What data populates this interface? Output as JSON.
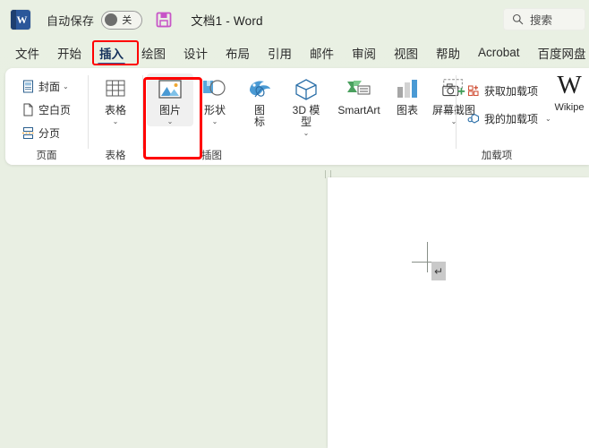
{
  "titlebar": {
    "app_logo": "word-logo",
    "logo_letter": "W",
    "autosave_label": "自动保存",
    "autosave_state": "关",
    "save_icon": "save-disk-icon",
    "document_title": "文档1 - Word"
  },
  "search": {
    "icon": "search-icon",
    "placeholder": "搜索"
  },
  "tabs": [
    {
      "label": "文件",
      "active": false
    },
    {
      "label": "开始",
      "active": false
    },
    {
      "label": "插入",
      "active": true
    },
    {
      "label": "绘图",
      "active": false
    },
    {
      "label": "设计",
      "active": false
    },
    {
      "label": "布局",
      "active": false
    },
    {
      "label": "引用",
      "active": false
    },
    {
      "label": "邮件",
      "active": false
    },
    {
      "label": "审阅",
      "active": false
    },
    {
      "label": "视图",
      "active": false
    },
    {
      "label": "帮助",
      "active": false
    },
    {
      "label": "Acrobat",
      "active": false
    },
    {
      "label": "百度网盘",
      "active": false
    }
  ],
  "ribbon": {
    "groups": [
      {
        "name": "pages",
        "label": "页面",
        "small_buttons": [
          {
            "label": "封面",
            "icon": "cover-page-icon",
            "caret": "⌄"
          },
          {
            "label": "空白页",
            "icon": "blank-page-icon",
            "caret": ""
          },
          {
            "label": "分页",
            "icon": "page-break-icon",
            "caret": ""
          }
        ]
      },
      {
        "name": "tables",
        "label": "表格",
        "big_buttons": [
          {
            "label": "表格",
            "icon": "table-icon",
            "caret": "⌄"
          }
        ]
      },
      {
        "name": "illustrations",
        "label": "插图",
        "big_buttons": [
          {
            "label": "图片",
            "icon": "picture-icon",
            "caret": "⌄",
            "selected": true
          },
          {
            "label": "形状",
            "icon": "shapes-icon",
            "caret": "⌄"
          },
          {
            "label": "图\n标",
            "icon": "icons-icon",
            "caret": ""
          },
          {
            "label": "3D 模\n型",
            "icon": "3d-model-icon",
            "caret": "⌄"
          },
          {
            "label": "SmartArt",
            "icon": "smartart-icon",
            "caret": ""
          },
          {
            "label": "图表",
            "icon": "chart-icon",
            "caret": ""
          },
          {
            "label": "屏幕截图",
            "icon": "screenshot-icon",
            "caret": "⌄"
          }
        ]
      },
      {
        "name": "addins",
        "label": "加载项",
        "small_buttons": [
          {
            "label": "获取加载项",
            "icon": "get-addins-icon",
            "caret": ""
          },
          {
            "label": "我的加载项",
            "icon": "my-addins-icon",
            "caret": "⌄"
          }
        ],
        "wikipedia": {
          "mark": "W",
          "label": "Wikipe"
        }
      }
    ]
  },
  "document": {
    "cursor": "crosshair-cursor",
    "paragraph_mark": "↵"
  },
  "colors": {
    "window_background": "#e9efe3",
    "ribbon_background": "#ffffff",
    "accent": "#2b579a",
    "highlight_box": "#ff0000",
    "page": "#ffffff",
    "save_icon": "#c755c7"
  }
}
